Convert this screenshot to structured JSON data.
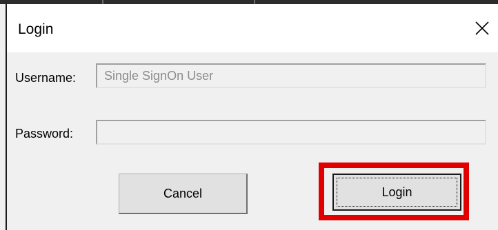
{
  "dialog": {
    "title": "Login",
    "close_icon": "close-icon"
  },
  "form": {
    "username_label": "Username:",
    "username_value": "Single SignOn User",
    "password_label": "Password:",
    "password_value": ""
  },
  "buttons": {
    "cancel_label": "Cancel",
    "login_label": "Login"
  },
  "colors": {
    "highlight": "#e00000",
    "background": "#f0f0f0"
  }
}
